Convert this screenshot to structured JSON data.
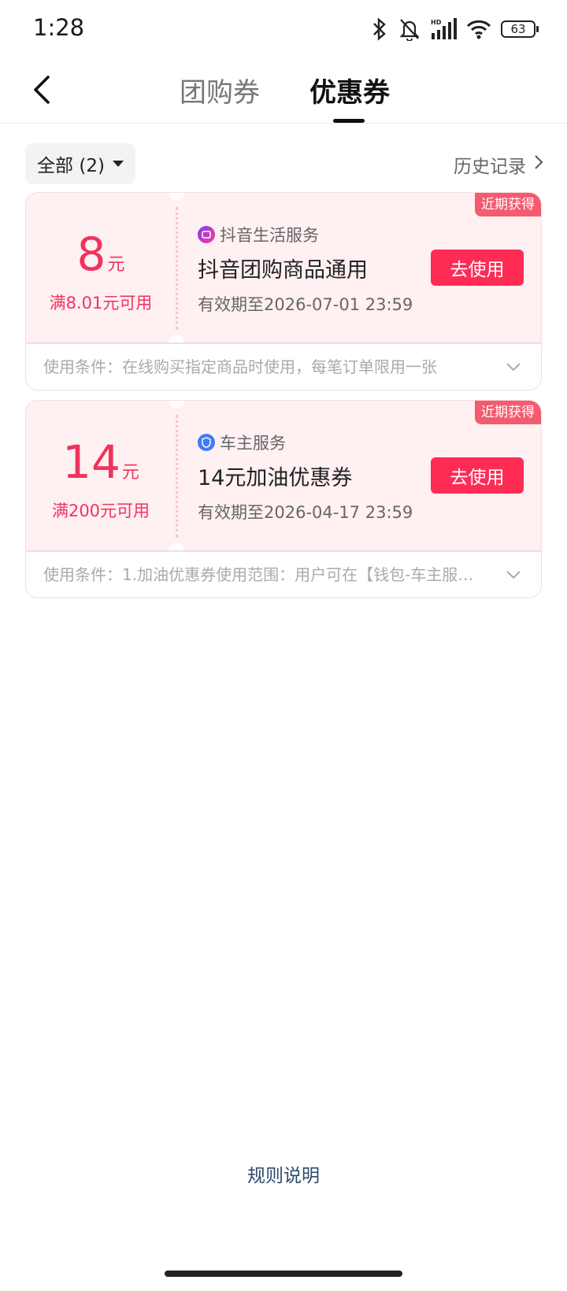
{
  "status_bar": {
    "time": "1:28",
    "battery": "63"
  },
  "header": {
    "tabs": [
      {
        "label": "团购券",
        "active": false
      },
      {
        "label": "优惠券",
        "active": true
      }
    ]
  },
  "filter": {
    "label": "全部 (2)",
    "history_label": "历史记录"
  },
  "coupons": [
    {
      "amount": "8",
      "unit": "元",
      "threshold": "满8.01元可用",
      "provider": "抖音生活服务",
      "title": "抖音团购商品通用",
      "validity": "有效期至2026-07-01 23:59",
      "button": "去使用",
      "badge": "近期获得",
      "conditions": "使用条件：在线购买指定商品时使用，每笔订单限用一张"
    },
    {
      "amount": "14",
      "unit": "元",
      "threshold": "满200元可用",
      "provider": "车主服务",
      "title": "14元加油优惠券",
      "validity": "有效期至2026-04-17 23:59",
      "button": "去使用",
      "badge": "近期获得",
      "conditions": "使用条件：1.加油优惠券使用范围：用户可在【钱包-车主服…"
    }
  ],
  "footer": {
    "rules_label": "规则说明"
  },
  "colors": {
    "accent": "#fe2c55",
    "coupon_bg": "#fff0f2",
    "badge": "#f45b6f"
  }
}
